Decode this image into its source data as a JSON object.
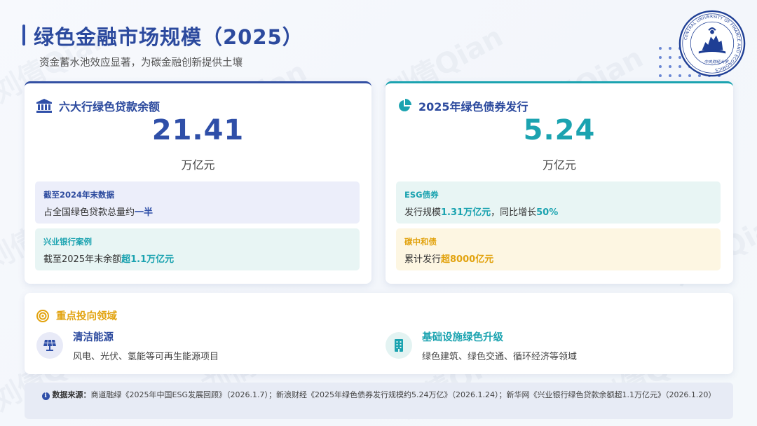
{
  "header": {
    "title": "绿色金融市场规模（2025）",
    "subtitle": "资金蓄水池效应显著，为碳金融创新提供土壤"
  },
  "logo": {
    "ring_text": "CENTRAL UNIVERSITY OF FINANCE AND ECONOMICS",
    "chinese_text": "中央财经大学"
  },
  "watermark_text": "刘倩Qian",
  "card_left": {
    "icon": "bank-icon",
    "title": "六大行绿色贷款余额",
    "value": "21.41",
    "unit": "万亿元",
    "info1": {
      "label": "截至2024年末数据",
      "text_prefix": "占全国绿色贷款总量约",
      "highlight": "一半"
    },
    "info2": {
      "label": "兴业银行案例",
      "text_prefix": "截至2025年末余额",
      "highlight": "超1.1万亿元"
    }
  },
  "card_right": {
    "icon": "pie-chart-icon",
    "title": "2025年绿色债券发行",
    "value": "5.24",
    "unit": "万亿元",
    "info1": {
      "label": "ESG债券",
      "text_prefix": "发行规模",
      "highlight1": "1.31万亿元",
      "text_mid": "，同比增长",
      "highlight2": "50%"
    },
    "info2": {
      "label": "碳中和债",
      "text_prefix": "累计发行",
      "highlight": "超8000亿元"
    }
  },
  "focus": {
    "icon": "target-icon",
    "title": "重点投向领域",
    "areas": [
      {
        "icon": "solar-panel-icon",
        "title": "清洁能源",
        "desc": "风电、光伏、氢能等可再生能源项目"
      },
      {
        "icon": "building-icon",
        "title": "基础设施绿色升级",
        "desc": "绿色建筑、绿色交通、循环经济等领域"
      }
    ]
  },
  "source": {
    "label": "数据来源：",
    "text": "商道融绿《2025年中国ESG发展回顾》（2026.1.7）；新浪财经《2025年绿色债券发行规模约5.24万亿》（2026.1.24）；新华网《兴业银行绿色贷款余额超1.1万亿元》（2026.1.20）"
  },
  "colors": {
    "navy": "#2f4fa8",
    "teal": "#1ba3b0",
    "gold": "#e2a30f"
  }
}
